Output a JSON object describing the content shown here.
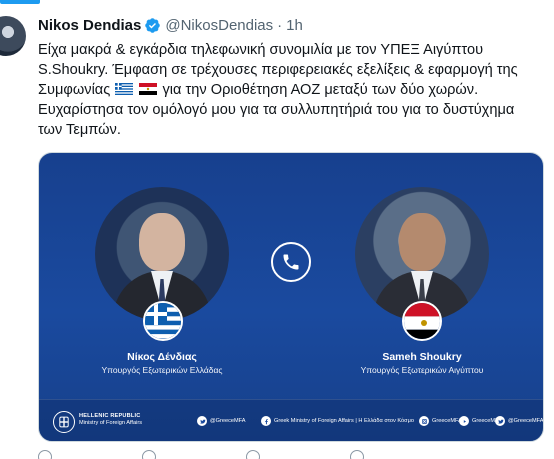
{
  "tweet": {
    "author_name": "Nikos Dendias",
    "handle": "@NikosDendias",
    "separator": "·",
    "time": "1h",
    "text_lines": [
      "Είχα μακρά & εγκάρδια τηλεφωνική συνομιλία με τον ΥΠΕΞ Αιγύπτου",
      "S.Shoukry. Έμφαση σε τρέχουσες περιφερειακές εξελίξεις & εφαρμογή της",
      "Συμφωνίας",
      "για την Οριοθέτηση ΑΟΖ μεταξύ των δύο χωρών.",
      "Ευχαρίστησα τον ομόλογό μου για τα συλλυπητήριά του για το δυστύχημα",
      "των Τεμπών."
    ],
    "flags": [
      "greece-flag-emoji",
      "egypt-flag-emoji"
    ]
  },
  "media": {
    "left_person": {
      "name": "Νίκος Δένδιας",
      "title": "Υπουργός Εξωτερικών Ελλάδας"
    },
    "right_person": {
      "name": "Sameh Shoukry",
      "title": "Υπουργός Εξωτερικών Αιγύπτου"
    },
    "call_icon": "phone-icon",
    "footer": {
      "ministry_line1": "HELLENIC REPUBLIC",
      "ministry_line2": "Ministry of Foreign Affairs",
      "socials": [
        {
          "icon": "twitter-icon",
          "label": "@GreeceMFA"
        },
        {
          "icon": "facebook-icon",
          "label": "Greek Ministry of Foreign Affairs | Η Ελλάδα στον Κόσμο"
        },
        {
          "icon": "instagram-icon",
          "label": "GreeceMFA"
        },
        {
          "icon": "youtube-icon",
          "label": "GreeceMFA"
        },
        {
          "icon": "twitter-icon",
          "label": "@GreeceMFA"
        }
      ]
    }
  },
  "colors": {
    "accent": "#1d9bf0",
    "card_blue": "#1a4a9f",
    "text": "#0f1419",
    "muted": "#536471"
  }
}
